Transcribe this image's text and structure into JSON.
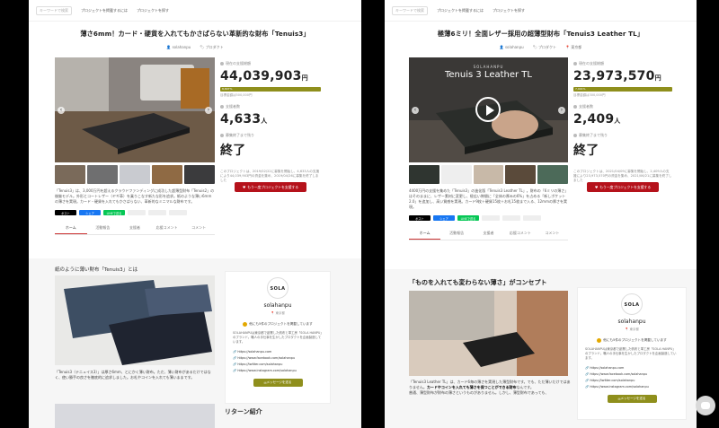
{
  "left": {
    "search_placeholder": "キーワードで検索",
    "nav": [
      "プロジェクトを掲載するには",
      "プロジェクトを探す"
    ],
    "title": "薄さ6mm！カード・硬貨を入れてもかさばらない革新的な財布「Tenuis3」",
    "owner": "solahanpu",
    "category": "プロダクト",
    "amount": "44,039,903",
    "amount_unit": "円",
    "amount_label": "現在の支援総額",
    "progress_label": "8,807%",
    "progress_fraction": 1.0,
    "goal": "目標金額は500,000円",
    "supporters_label": "支援者数",
    "supporters": "4,633",
    "supporters_unit": "人",
    "remain_label": "募集終了まで残り",
    "status": "終了",
    "end_note": "このプロジェクトは、2019/02/22に募集を開始し、4,633人の支援により44,039,903円の資金を集め、2019/04/26に募集を終了しました",
    "support_btn": "もう一度プロジェクトを支援する",
    "description": "「Tenuis3」は、3,000万円を超えるクラウドファンディングに成功した超薄型財布「Tenuis2」の後継モデル。外形とコートレザー（ヤギ革）を乗りこなす新たな形を追求。紙のような薄い6mmの薄さを実現。カード・硬貨を入れてもかさばらない、革新的なミニマルな財布です。",
    "share": [
      "ポスト",
      "シェア",
      "LINEで送る"
    ],
    "tabs": [
      "ホーム",
      "活動報告",
      "支援者",
      "応援コメント",
      "コメント"
    ],
    "section_heading": "紙のように薄い財布「Tenuis3」とは",
    "body_text": "「Tenuis3（テニュイス3）」は厚さ6mm、とにかく薄い財布。ただ、薄い財布があるだけではなく、使い勝手の良さを徹底的に追求しました。お札やコインを入れても薄いままです。",
    "next_heading": "リターン紹介"
  },
  "right": {
    "search_placeholder": "キーワードで検索",
    "nav": [
      "プロジェクトを掲載するには",
      "プロジェクトを探す"
    ],
    "title": "極薄6ミリ！全面レザー採用の超薄型財布「Tenuis3 Leather TL」",
    "owner": "solahanpu",
    "category": "プロダクト",
    "category2": "東京都",
    "video_brand": "SOLAHANPU",
    "video_title": "Tenuis 3 Leather TL",
    "amount": "23,973,570",
    "amount_unit": "円",
    "amount_label": "現在の支援総額",
    "progress_label": "7,991%",
    "progress_fraction": 1.0,
    "goal": "目標金額は300,000円",
    "supporters_label": "支援者数",
    "supporters": "2,409",
    "supporters_unit": "人",
    "remain_label": "募集終了まで残り",
    "status": "終了",
    "end_note": "このプロジェクトは、2021/04/09に募集を開始し、2,409人の支援により23,973,570円の資金を集め、2021/06/21に募集を終了しました",
    "support_btn": "もう一度プロジェクトを支援する",
    "description": "4400万円の支援を集めた「Tenuis3」の進化版「Tenuis3 Leather TL」。財布の「6ミリの薄さ」はそのままに、レザー素材に変更し、極広い隙間に「全体の厚みの6%」を占める「新しポケット2.0」を追加し、高い質感を実現。カード9枚＋硬貨15枚＋お札15枚まで入る、12mmの厚さを実現。",
    "share": [
      "ポスト",
      "シェア",
      "LINEで送る"
    ],
    "tabs": [
      "ホーム",
      "活動報告",
      "支援者",
      "応援コメント",
      "コメント"
    ],
    "section_heading": "「ものを入れても変わらない薄さ」がコンセプト",
    "body_text_1": "「Tenuis3 Leather TL」は、カード6毎の薄さを実現した薄型財布です。でも、ただ薄いだけではありません。",
    "body_text_bold": "カードやコインを入れても薄さを保つことができる財布",
    "body_text_2": "なんです。",
    "body_text_3": "普通、薄型財布が財布の薄さというものがありません。しかし、薄型財布であっても、"
  },
  "profile": {
    "logo": "SOLA",
    "name": "solahanpu",
    "location": "東京都",
    "badge": "他にも5件のプロジェクトを掲載しています",
    "desc": "SOLAHANPUは東京都で創業した帆布と革工房「SOLA HANPU」のブランド。職人の手仕事を生かしたプロダクトを企画製造しています。",
    "links": [
      "https://solahanpu.com",
      "https://www.facebook.com/solahanpu",
      "https://twitter.com/solahanpu",
      "https://www.instagram.com/solahanpu"
    ],
    "message_btn": "メッセージを送る"
  }
}
